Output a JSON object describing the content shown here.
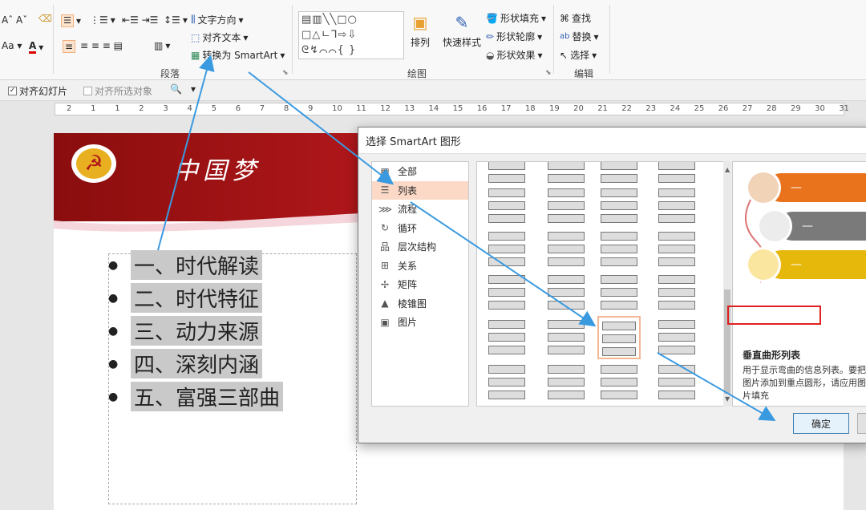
{
  "ribbon": {
    "font_group_label": "",
    "paragraph": {
      "label": "段落",
      "text_direction": "文字方向",
      "align_text": "对齐文本",
      "convert_smartart": "转换为 SmartArt"
    },
    "drawing": {
      "label": "绘图",
      "arrange": "排列",
      "quick_styles": "快速样式",
      "shape_fill": "形状填充",
      "shape_outline": "形状轮廓",
      "shape_effects": "形状效果"
    },
    "editing": {
      "label": "编辑",
      "find": "查找",
      "replace": "替换",
      "select": "选择"
    }
  },
  "subbar": {
    "align_slide": "对齐幻灯片",
    "align_selected": "对齐所选对象"
  },
  "ruler": {
    "ticks": [
      "2",
      "1",
      "1",
      "2",
      "3",
      "4",
      "5",
      "6",
      "7",
      "8",
      "9",
      "10",
      "11",
      "12",
      "13",
      "14",
      "15",
      "16",
      "17",
      "18",
      "19",
      "20",
      "21",
      "22",
      "23",
      "24",
      "25",
      "26",
      "27",
      "28",
      "29",
      "30",
      "31"
    ]
  },
  "slide": {
    "banner_title": "中国梦",
    "bullets": [
      "一、时代解读",
      "二、时代特征",
      "三、动力来源",
      "四、深刻内涵",
      "五、富强三部曲"
    ]
  },
  "dialog": {
    "title": "选择 SmartArt 图形",
    "categories": [
      {
        "label": "全部",
        "icon": "all-icon"
      },
      {
        "label": "列表",
        "icon": "list-icon"
      },
      {
        "label": "流程",
        "icon": "process-icon"
      },
      {
        "label": "循环",
        "icon": "cycle-icon"
      },
      {
        "label": "层次结构",
        "icon": "hierarchy-icon"
      },
      {
        "label": "关系",
        "icon": "relationship-icon"
      },
      {
        "label": "矩阵",
        "icon": "matrix-icon"
      },
      {
        "label": "棱锥图",
        "icon": "pyramid-icon"
      },
      {
        "label": "图片",
        "icon": "picture-icon"
      }
    ],
    "selected_category": "列表",
    "preview_name": "垂直曲形列表",
    "preview_desc": "用于显示弯曲的信息列表。要把图片添加到重点圆形，请应用图片填充",
    "ok": "确定"
  },
  "colors": {
    "banner_red": "#b0171b",
    "selection_orange": "#fbd9c6",
    "arrow_blue": "#3a9ae0",
    "highlight_red": "#e02020"
  }
}
